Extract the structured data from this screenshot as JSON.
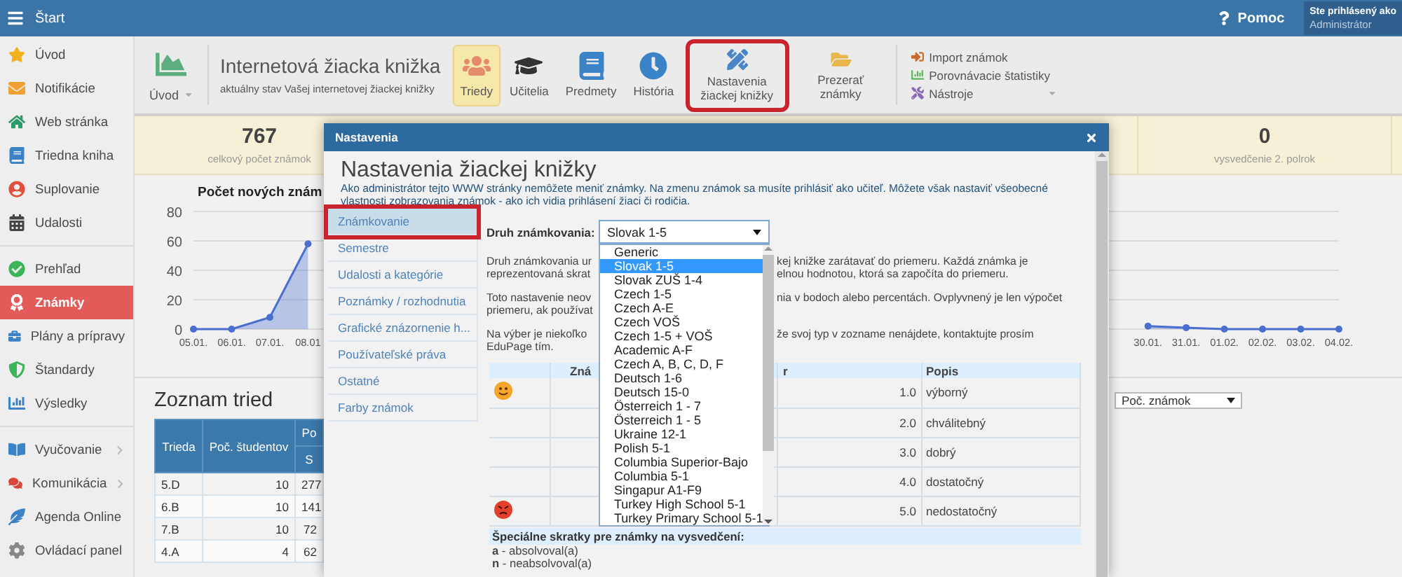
{
  "top_bar": {
    "menu_label": "Štart",
    "help": "Pomoc",
    "user_caption": "Ste prihlásený ako",
    "user_name": "Administrátor"
  },
  "sidebar": {
    "groups": [
      {
        "items": [
          {
            "label": "Úvod",
            "selected": false,
            "has_submenu": false
          },
          {
            "label": "Notifikácie",
            "selected": false,
            "has_submenu": false
          },
          {
            "label": "Web stránka",
            "selected": false,
            "has_submenu": false
          },
          {
            "label": "Triedna kniha",
            "selected": false,
            "has_submenu": false
          },
          {
            "label": "Suplovanie",
            "selected": false,
            "has_submenu": false
          },
          {
            "label": "Udalosti",
            "selected": false,
            "has_submenu": false
          }
        ]
      },
      {
        "items": [
          {
            "label": "Prehľad",
            "selected": false,
            "has_submenu": false
          },
          {
            "label": "Známky",
            "selected": true,
            "has_submenu": false
          },
          {
            "label": "Plány a prípravy",
            "selected": false,
            "has_submenu": false
          },
          {
            "label": "Štandardy",
            "selected": false,
            "has_submenu": false
          },
          {
            "label": "Výsledky",
            "selected": false,
            "has_submenu": false
          }
        ]
      },
      {
        "items": [
          {
            "label": "Vyučovanie",
            "selected": false,
            "has_submenu": true
          },
          {
            "label": "Komunikácia",
            "selected": false,
            "has_submenu": true
          },
          {
            "label": "Agenda Online",
            "selected": false,
            "has_submenu": false
          },
          {
            "label": "Ovládací panel",
            "selected": false,
            "has_submenu": false
          }
        ]
      }
    ]
  },
  "ribbon": {
    "home_button": "Úvod",
    "title": "Internetová žiacka knižka",
    "subtitle": "aktuálny stav Vašej internetovej žiackej knižky",
    "buttons": [
      {
        "label": "Triedy",
        "selected": true,
        "highlighted": false
      },
      {
        "label": "Učitelia",
        "selected": false,
        "highlighted": false
      },
      {
        "label": "Predmety",
        "selected": false,
        "highlighted": false
      },
      {
        "label": "História",
        "selected": false,
        "highlighted": false
      },
      {
        "label": "Nastavenia žiackej knižky",
        "selected": false,
        "highlighted": true
      },
      {
        "label": "Prezerať známky",
        "selected": false,
        "highlighted": false
      }
    ],
    "tools": [
      {
        "label": "Import známok",
        "has_menu": false
      },
      {
        "label": "Porovnávacie štatistiky",
        "has_menu": false
      },
      {
        "label": "Nástroje",
        "has_menu": true
      }
    ]
  },
  "stats": [
    {
      "value": "767",
      "label": "celkový počet známok"
    },
    {
      "value": "0",
      "label": "vysvedčenie 2. polrok"
    }
  ],
  "chart": {
    "chart_data": {
      "type": "area",
      "title": "Počet nových znám",
      "categories": [
        "05.01.",
        "06.01.",
        "07.01.",
        "08.01",
        null,
        null,
        null,
        null,
        null,
        null,
        null,
        null,
        null,
        null,
        null,
        null,
        null,
        null,
        null,
        null,
        null,
        null,
        null,
        null,
        null,
        "30.01.",
        "31.01.",
        "01.02.",
        "02.02.",
        "03.02.",
        "04.02."
      ],
      "series": [
        {
          "color": "#4a6fd0",
          "values": [
            0,
            0,
            8,
            58,
            null,
            null,
            null,
            null,
            null,
            null,
            null,
            null,
            null,
            null,
            null,
            null,
            null,
            null,
            null,
            null,
            null,
            null,
            null,
            null,
            null,
            2,
            1,
            0,
            0,
            0,
            0
          ]
        }
      ],
      "ylim": [
        0,
        80
      ],
      "yticks": [
        0,
        20,
        40,
        60,
        80
      ],
      "grid": true
    }
  },
  "classes": {
    "title": "Zoznam tried",
    "columns": [
      "Trieda",
      "Poč. študentov",
      "Po"
    ],
    "subcolumns": [
      "S"
    ],
    "rows": [
      [
        "5.D",
        "10",
        "277"
      ],
      [
        "6.B",
        "10",
        "141"
      ],
      [
        "7.B",
        "10",
        "72"
      ],
      [
        "4.A",
        "4",
        "62"
      ]
    ],
    "sort_select": "Poč. známok"
  },
  "modal": {
    "title": "Nastavenia",
    "heading": "Nastavenia žiackej knižky",
    "description": "Ako administrátor tejto WWW stránky nemôžete meniť známky. Na zmenu známok sa musíte prihlásiť ako učiteľ. Môžete však nastaviť všeobecné vlastnosti zobrazovania známok - ako ich vidia prihlásení žiaci či rodičia.",
    "menu": [
      {
        "label": "Známkovanie",
        "selected": true,
        "highlighted": true
      },
      {
        "label": "Semestre",
        "selected": false,
        "highlighted": false
      },
      {
        "label": "Udalosti a kategórie",
        "selected": false,
        "highlighted": false
      },
      {
        "label": "Poznámky / rozhodnutia",
        "selected": false,
        "highlighted": false
      },
      {
        "label": "Grafické znázornenie h...",
        "selected": false,
        "highlighted": false
      },
      {
        "label": "Používateľské práva",
        "selected": false,
        "highlighted": false
      },
      {
        "label": "Ostatné",
        "selected": false,
        "highlighted": false
      },
      {
        "label": "Farby známok",
        "selected": false,
        "highlighted": false
      }
    ],
    "grading": {
      "label": "Druh známkovania:",
      "value": "Slovak 1-5",
      "expanded": true,
      "options": [
        {
          "label": "Generic",
          "selected": false
        },
        {
          "label": "Slovak 1-5",
          "selected": true
        },
        {
          "label": "Slovak ZUŠ 1-4",
          "selected": false
        },
        {
          "label": "Czech 1-5",
          "selected": false
        },
        {
          "label": "Czech A-E",
          "selected": false
        },
        {
          "label": "Czech VOŠ",
          "selected": false
        },
        {
          "label": "Czech 1-5 + VOŠ",
          "selected": false
        },
        {
          "label": "Academic A-F",
          "selected": false
        },
        {
          "label": "Czech A, B, C, D, F",
          "selected": false
        },
        {
          "label": "Deutsch 1-6",
          "selected": false
        },
        {
          "label": "Deutsch 15-0",
          "selected": false
        },
        {
          "label": "Österreich 1 - 7",
          "selected": false
        },
        {
          "label": "Österreich 1 - 5",
          "selected": false
        },
        {
          "label": "Ukraine 12-1",
          "selected": false
        },
        {
          "label": "Polish 5-1",
          "selected": false
        },
        {
          "label": "Columbia Superior-Bajo",
          "selected": false
        },
        {
          "label": "Columbia 5-1",
          "selected": false
        },
        {
          "label": "Singapur A1-F9",
          "selected": false
        },
        {
          "label": "Turkey High School 5-1",
          "selected": false
        },
        {
          "label": "Turkey Primary School 5-1",
          "selected": false
        }
      ]
    },
    "paragraphs": [
      [
        {
          "left": "Druh známkovania ur",
          "right": "kej knižke zarátavať do priemeru. Každá známka je"
        },
        {
          "left": "reprezentovaná skrat",
          "right": "elnou hodnotou, ktorá sa započíta do priemeru."
        }
      ],
      [
        {
          "left": "Toto nastavenie neov",
          "right": "nia v bodoch alebo percentách. Ovplyvnený je len výpočet"
        },
        {
          "left": "priemeru, ak používat"
        }
      ],
      [
        {
          "left": "Na výber je niekoľko",
          "right": "že svoj typ v zozname nenájdete, kontaktujte prosím"
        },
        {
          "left": "EduPage tím."
        }
      ]
    ],
    "grade_table": {
      "columns": [
        "Zná",
        "r",
        "Popis"
      ],
      "rows": [
        {
          "kind": "smiling",
          "value": "1.0",
          "description": "výborný"
        },
        {
          "kind": "plain",
          "value": "2.0",
          "description": "chválitebný"
        },
        {
          "kind": "plain",
          "value": "3.0",
          "description": "dobrý"
        },
        {
          "kind": "plain",
          "value": "4.0",
          "description": "dostatočný"
        },
        {
          "kind": "angry",
          "value": "5.0",
          "description": "nedostatočný"
        }
      ]
    },
    "special": {
      "heading": "Špeciálne skratky pre známky na vysvedčení:",
      "items": [
        "**a** - absolvoval(a)",
        "**n** - neabsolvoval(a)"
      ]
    }
  }
}
